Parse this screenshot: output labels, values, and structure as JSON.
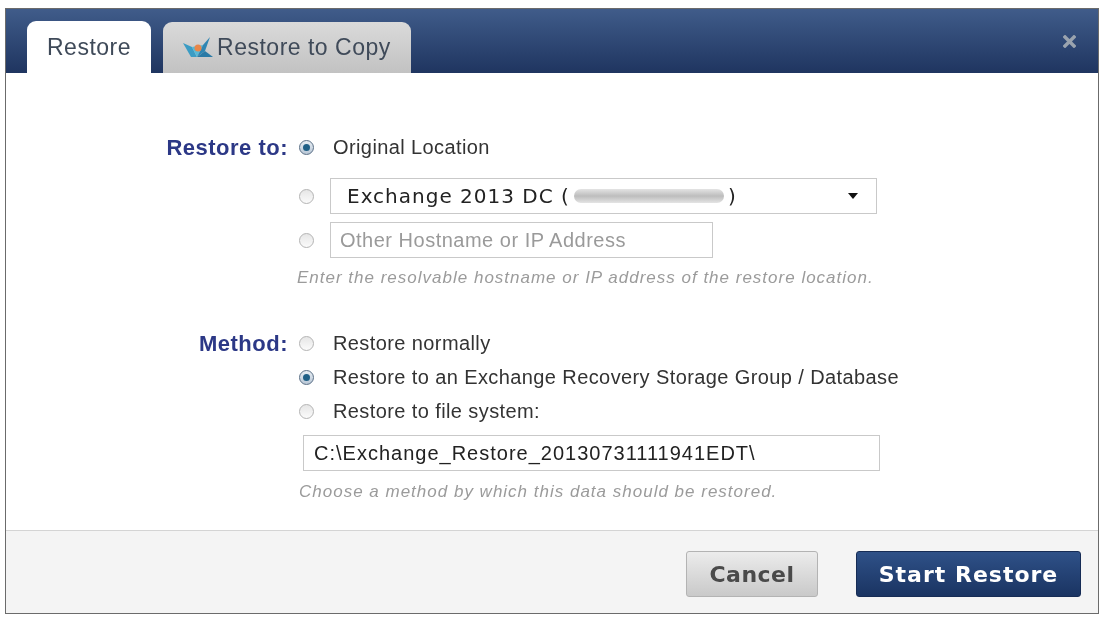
{
  "tabs": [
    {
      "label": "Restore",
      "selected": true
    },
    {
      "label": "Restore to Copy",
      "selected": false
    }
  ],
  "restore_to": {
    "label": "Restore to:",
    "options": [
      {
        "kind": "text",
        "label": "Original Location",
        "selected": true
      },
      {
        "kind": "dropdown",
        "value_start": "Exchange 2013 DC (",
        "value_end": ")",
        "selected": false
      },
      {
        "kind": "input",
        "placeholder": "Other Hostname or IP Address",
        "selected": false
      }
    ],
    "hint": "Enter the resolvable hostname or IP address of the restore location."
  },
  "method": {
    "label": "Method:",
    "options": [
      {
        "label": "Restore normally",
        "selected": false
      },
      {
        "label": "Restore to an Exchange Recovery Storage Group / Database",
        "selected": true
      },
      {
        "label": "Restore to file system:",
        "selected": false
      }
    ],
    "path": {
      "value": "C:\\Exchange_Restore_20130731111941EDT\\"
    },
    "hint": "Choose a method by which this data should be restored."
  },
  "buttons": [
    {
      "label": "Cancel",
      "kind": "secondary"
    },
    {
      "label": "Start Restore",
      "kind": "primary"
    }
  ]
}
